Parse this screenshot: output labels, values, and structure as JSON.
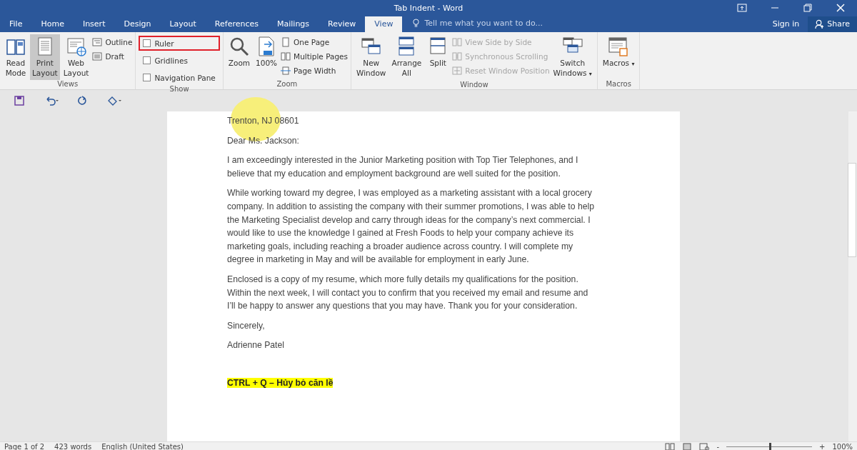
{
  "window": {
    "title": "Tab Indent - Word"
  },
  "tabs": [
    {
      "label": "File",
      "selected": false
    },
    {
      "label": "Home",
      "selected": false
    },
    {
      "label": "Insert",
      "selected": false
    },
    {
      "label": "Design",
      "selected": false
    },
    {
      "label": "Layout",
      "selected": false
    },
    {
      "label": "References",
      "selected": false
    },
    {
      "label": "Mailings",
      "selected": false
    },
    {
      "label": "Review",
      "selected": false
    },
    {
      "label": "View",
      "selected": true
    }
  ],
  "tell_me": {
    "placeholder": "Tell me what you want to do..."
  },
  "account": {
    "sign_in": "Sign in",
    "share": "Share"
  },
  "ribbon": [
    {
      "label": "Views",
      "items": [
        {
          "kind": "big",
          "label": "Read Mode",
          "selected": false
        },
        {
          "kind": "big",
          "label": "Print Layout",
          "selected": true
        },
        {
          "kind": "big",
          "label": "Web Layout",
          "selected": false
        },
        {
          "kind": "small",
          "label": "Outline",
          "disabled": false
        },
        {
          "kind": "small",
          "label": "Draft",
          "disabled": false
        }
      ]
    },
    {
      "label": "Show",
      "items": [
        {
          "kind": "check",
          "label": "Ruler",
          "checked": false,
          "highlighted": true
        },
        {
          "kind": "check",
          "label": "Gridlines",
          "checked": false,
          "highlighted": false
        },
        {
          "kind": "check",
          "label": "Navigation Pane",
          "checked": false,
          "highlighted": false
        }
      ]
    },
    {
      "label": "Zoom",
      "items": [
        {
          "kind": "big",
          "label": "Zoom",
          "selected": false
        },
        {
          "kind": "big",
          "label": "100%",
          "selected": false
        },
        {
          "kind": "small",
          "label": "One Page",
          "disabled": false
        },
        {
          "kind": "small",
          "label": "Multiple Pages",
          "disabled": false
        },
        {
          "kind": "small",
          "label": "Page Width",
          "disabled": false
        }
      ]
    },
    {
      "label": "Window",
      "items": [
        {
          "kind": "big",
          "label": "New Window",
          "selected": false
        },
        {
          "kind": "big",
          "label": "Arrange All",
          "selected": false
        },
        {
          "kind": "big",
          "label": "Split",
          "selected": false
        },
        {
          "kind": "small",
          "label": "View Side by Side",
          "disabled": true
        },
        {
          "kind": "small",
          "label": "Synchronous Scrolling",
          "disabled": true
        },
        {
          "kind": "small",
          "label": "Reset Window Position",
          "disabled": true
        },
        {
          "kind": "big",
          "label": "Switch Windows",
          "selected": false,
          "caret": "▾"
        }
      ]
    },
    {
      "label": "Macros",
      "items": [
        {
          "kind": "big",
          "label": "Macros",
          "selected": false,
          "caret": "▾"
        }
      ]
    }
  ],
  "document": {
    "cursor_highlight": true,
    "paragraphs": [
      {
        "kind": "normal",
        "lines": [
          "Trenton, NJ 08601"
        ]
      },
      {
        "kind": "normal",
        "lines": [
          "Dear Ms. Jackson:"
        ]
      },
      {
        "kind": "normal",
        "lines": [
          "I am exceedingly interested in the Junior Marketing position with Top Tier Telephones, and I",
          "believe that my education and employment background are well suited for the position."
        ]
      },
      {
        "kind": "normal",
        "lines": [
          "While working toward my degree, I was employed as a marketing assistant with a local grocery",
          "company. In addition to assisting the company with their summer promotions, I was able to help",
          "the Marketing Specialist develop and carry through ideas for the company’s next commercial. I",
          "would like to use the knowledge I gained at Fresh Foods to help your company achieve its",
          "marketing goals, including reaching a broader audience across country. I will complete my",
          "degree in marketing in May and will be available for employment in early June."
        ]
      },
      {
        "kind": "normal",
        "lines": [
          "Enclosed is a copy of my resume, which more fully details my qualifications for the position.",
          "Within the next week, I will contact you to confirm that you received my email and resume and",
          "I’ll be happy to answer any questions that you may have. Thank you for your consideration."
        ]
      },
      {
        "kind": "normal",
        "lines": [
          "Sincerely,"
        ]
      },
      {
        "kind": "normal",
        "lines": [
          "Adrienne Patel"
        ]
      },
      {
        "kind": "highlight",
        "lines": [
          "CTRL + Q – Hủy bỏ căn lề"
        ]
      }
    ]
  },
  "status_bar": {
    "page": "Page 1 of 2",
    "words": "423 words",
    "language": "English (United States)",
    "zoom": {
      "zoom_out": "-",
      "level": 0.5,
      "zoom_in": "+",
      "reading": "100%"
    }
  }
}
